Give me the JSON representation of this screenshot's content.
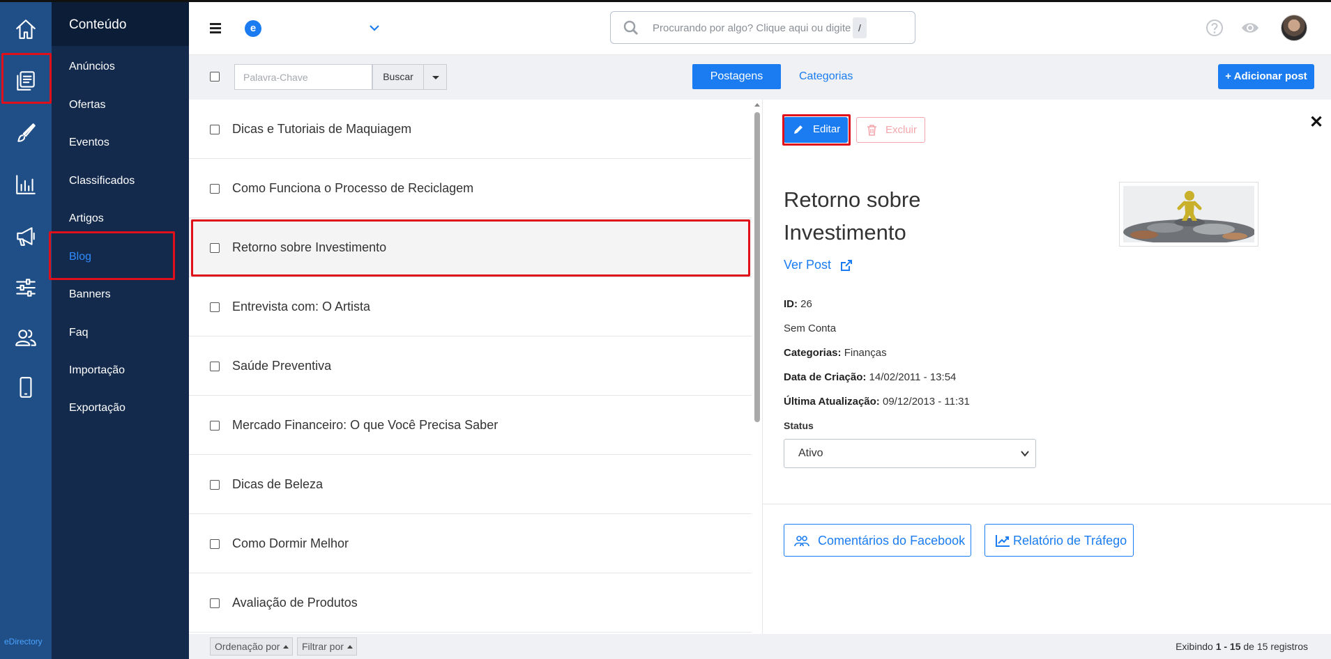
{
  "sidebar": {
    "title": "Conteúdo",
    "items": [
      "Anúncios",
      "Ofertas",
      "Eventos",
      "Classificados",
      "Artigos",
      "Blog",
      "Banners",
      "Faq",
      "Importação",
      "Exportação"
    ],
    "active": "Blog"
  },
  "rail": {
    "icons": [
      "home-icon",
      "content-icon",
      "brush-icon",
      "chart-icon",
      "megaphone-icon",
      "sliders-icon",
      "users-icon",
      "mobile-icon"
    ],
    "brand": "eDirectory"
  },
  "topbar": {
    "logo_letter": "e",
    "search_placeholder": "Procurando por algo? Clique aqui ou digite",
    "search_shortcut": "/"
  },
  "toolbar": {
    "keyword_placeholder": "Palavra-Chave",
    "search_button": "Buscar",
    "tabs": [
      "Postagens",
      "Categorias"
    ],
    "active_tab": "Postagens",
    "add_button": "+ Adicionar post"
  },
  "posts": [
    "Dicas e Tutoriais de Maquiagem",
    "Como Funciona o Processo de Reciclagem",
    "Retorno sobre Investimento",
    "Entrevista com: O Artista",
    "Saúde Preventiva",
    "Mercado Financeiro: O que Você Precisa Saber",
    "Dicas de Beleza",
    "Como Dormir Melhor",
    "Avaliação de Produtos"
  ],
  "selected_post_index": 2,
  "detail": {
    "edit_label": "Editar",
    "delete_label": "Excluir",
    "title": "Retorno sobre Investimento",
    "view_link": "Ver Post",
    "id_label": "ID:",
    "id_value": "26",
    "account": "Sem Conta",
    "categories_label": "Categorias:",
    "categories_value": "Finanças",
    "created_label": "Data de Criação:",
    "created_value": "14/02/2011 - 13:54",
    "updated_label": "Última Atualização:",
    "updated_value": "09/12/2013 - 11:31",
    "status_label": "Status",
    "status_value": "Ativo",
    "facebook_button": "Comentários do Facebook",
    "traffic_button": "Relatório de Tráfego"
  },
  "footer": {
    "sort_label": "Ordenação por",
    "filter_label": "Filtrar por",
    "showing_prefix": "Exibindo",
    "showing_range": "1 - 15",
    "showing_middle": "de 15 registros"
  },
  "colors": {
    "rail_bg": "#1f4f86",
    "sidebar_bg": "#132a4d",
    "accent": "#1a7cf0",
    "highlight": "#e0101a",
    "danger": "#f3a5ab"
  }
}
